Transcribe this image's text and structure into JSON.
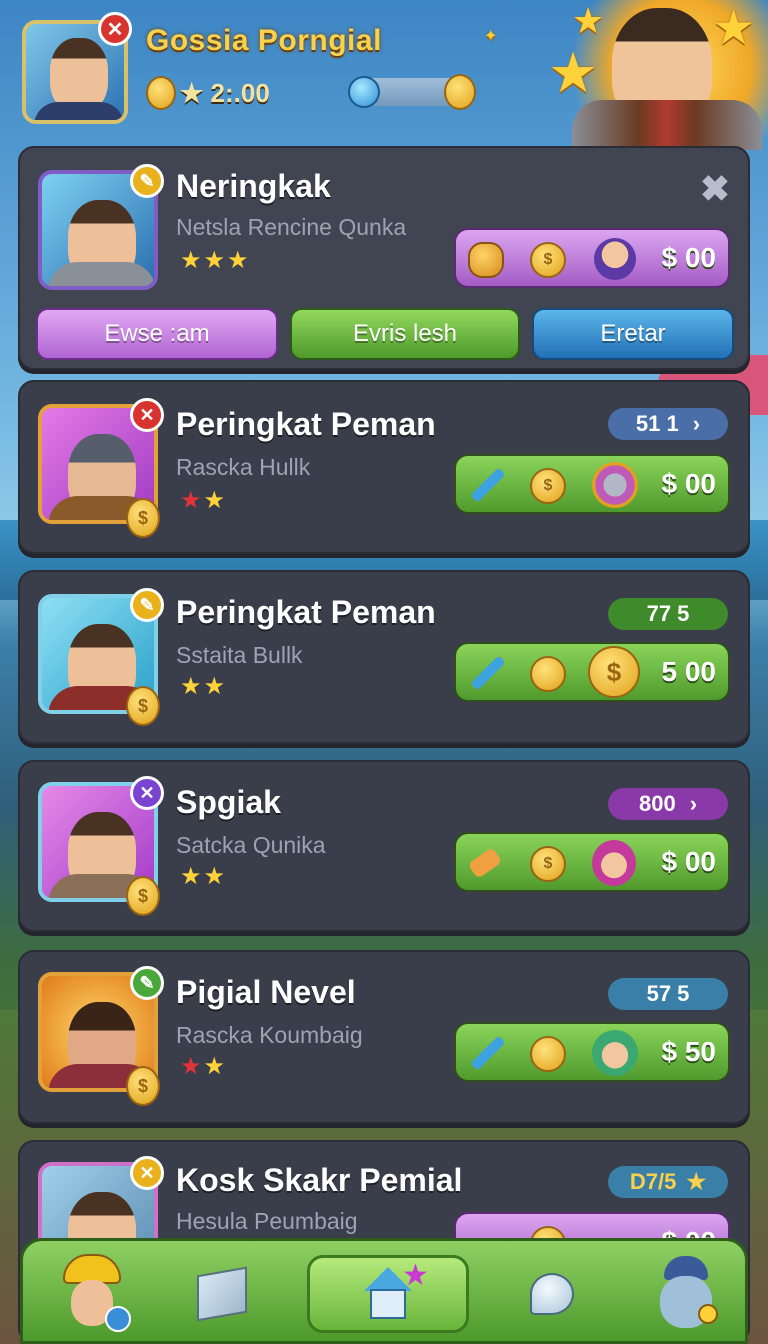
{
  "header": {
    "player_name": "Gossia Porngial",
    "coins": "★ 2:.00",
    "energy_fraction": 0.2
  },
  "cards": [
    {
      "title": "Neringkak",
      "subtitle": "Netsla Rencine Qunka",
      "stars": [
        "yellow",
        "yellow",
        "yellow"
      ],
      "price": "$ 00",
      "badge": "✎",
      "buttons": [
        {
          "label": "Ewse :am"
        },
        {
          "label": "Evris lesh"
        },
        {
          "label": "Eretar"
        }
      ]
    },
    {
      "title": "Peringkat Peman",
      "subtitle": "Rascka Hullk",
      "stars": [
        "red",
        "yellow"
      ],
      "tag": "51 1",
      "tag_arrow": "›",
      "price": "$ 00",
      "badge": "✕"
    },
    {
      "title": "Peringkat Peman",
      "subtitle": "Sstaita Bullk",
      "stars": [
        "yellow",
        "yellow"
      ],
      "tag": "77 5",
      "price": "5 00",
      "badge": "✎"
    },
    {
      "title": "Spgiak",
      "subtitle": "Satcka Qunika",
      "stars": [
        "yellow",
        "yellow"
      ],
      "tag": "800",
      "tag_arrow": "›",
      "price": "$ 00",
      "badge": "✕"
    },
    {
      "title": "Pigial Nevel",
      "subtitle": "Rascka Koumbaig",
      "stars": [
        "red",
        "yellow"
      ],
      "tag": "57 5",
      "price": "$ 50",
      "badge": "✎"
    },
    {
      "title": "Kosk Skakr Pemial",
      "subtitle": "Hesula Peumbaig",
      "tag": "D7/5",
      "tag_star": "★",
      "price": "$ 00",
      "badge": "✕"
    }
  ],
  "icons": {
    "coin_symbol": "$",
    "close": "✖",
    "star": "★"
  },
  "colors": {
    "card_bg": "#3a3d4a",
    "gold": "#f7d24a",
    "green_button": "#4f9a2c",
    "purple_button": "#b064d2",
    "blue_button": "#2270b6"
  }
}
